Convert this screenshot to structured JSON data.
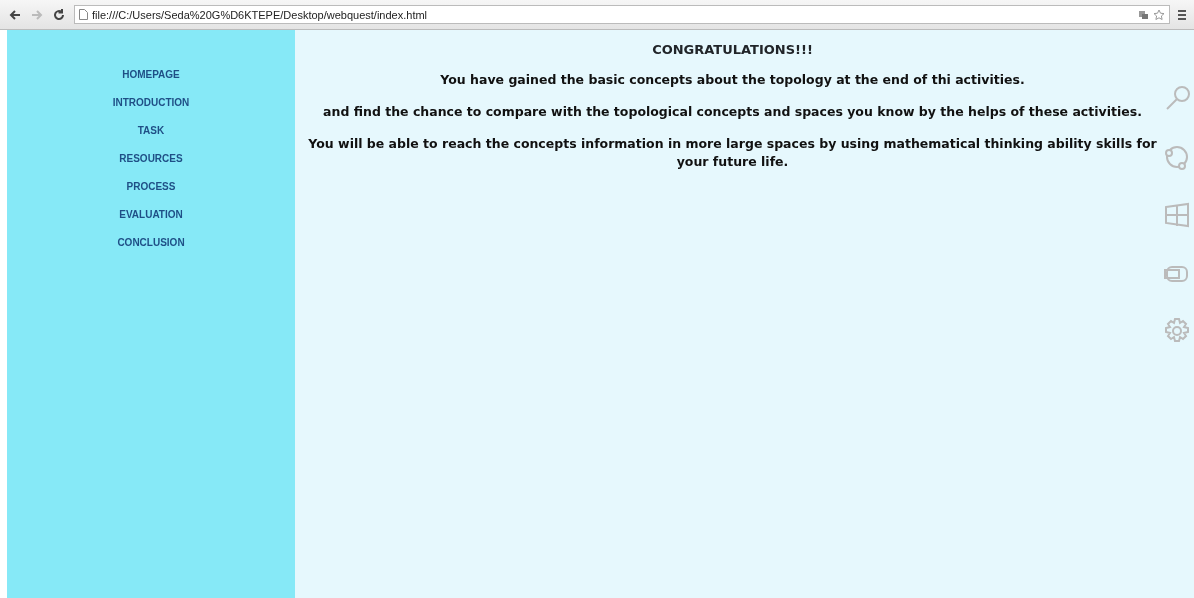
{
  "browser": {
    "address": "file:///C:/Users/Seda%20G%D6KTEPE/Desktop/webquest/index.html"
  },
  "sidebar": {
    "items": [
      {
        "label": "HOMEPAGE"
      },
      {
        "label": "INTRODUCTION"
      },
      {
        "label": "TASK"
      },
      {
        "label": "RESOURCES"
      },
      {
        "label": "PROCESS"
      },
      {
        "label": "EVALUATION"
      },
      {
        "label": "CONCLUSION"
      }
    ]
  },
  "content": {
    "heading": "CONGRATULATIONS!!!",
    "paragraphs": [
      "You have gained the basic concepts about the topology at the end of thi activities.",
      "and find the chance to compare with the topological concepts and spaces you know by the helps of these activities.",
      "You will be able to reach the concepts information in more large spaces by using mathematical thinking ability skills for your future life."
    ]
  },
  "charms": [
    {
      "kind": "search"
    },
    {
      "kind": "share"
    },
    {
      "kind": "start"
    },
    {
      "kind": "devices"
    },
    {
      "kind": "settings"
    }
  ]
}
